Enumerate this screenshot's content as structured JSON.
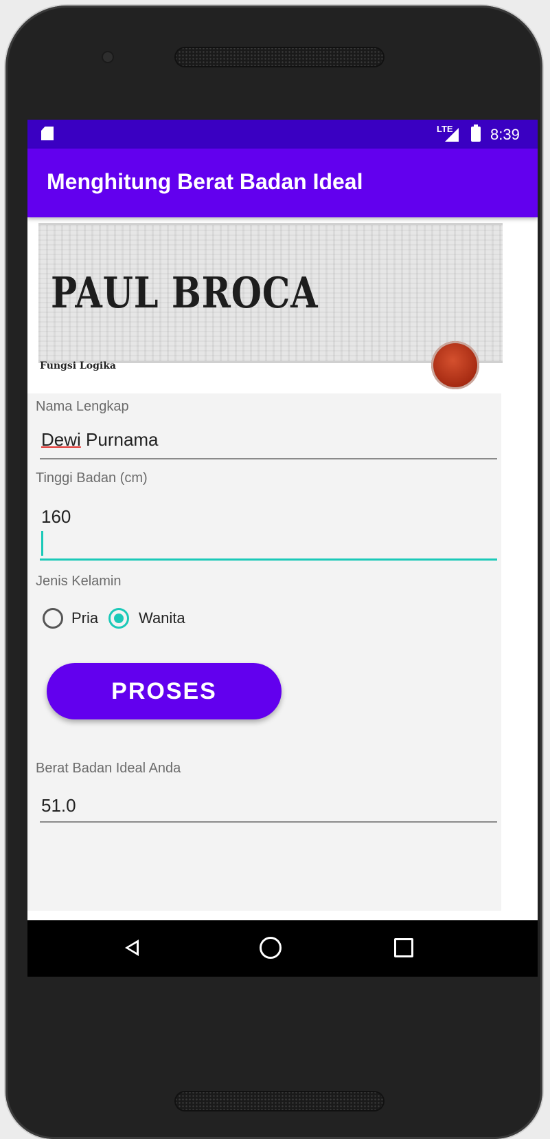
{
  "status_bar": {
    "network": "LTE",
    "time": "8:39",
    "icons": [
      "sd-card-icon",
      "signal-icon",
      "battery-icon"
    ]
  },
  "app_bar": {
    "title": "Menghitung Berat Badan Ideal"
  },
  "banner": {
    "title": "PAUL BROCA",
    "caption": "Fungsi Logika"
  },
  "form": {
    "name_label": "Nama Lengkap",
    "name_first": "Dewi",
    "name_rest": " Purnama",
    "height_label": "Tinggi Badan (cm)",
    "height_value": "160",
    "gender_label": "Jenis Kelamin",
    "gender_options": [
      {
        "label": "Pria",
        "checked": false
      },
      {
        "label": "Wanita",
        "checked": true
      }
    ],
    "submit_label": "PROSES",
    "result_label": "Berat Badan Ideal Anda",
    "result_value": "51.0"
  },
  "nav_bar": {
    "icons": [
      "back-icon",
      "home-icon",
      "recents-icon"
    ]
  },
  "colors": {
    "primary": "#6200ee",
    "primary_dark": "#3a00c2",
    "accent": "#1bc9b8"
  }
}
